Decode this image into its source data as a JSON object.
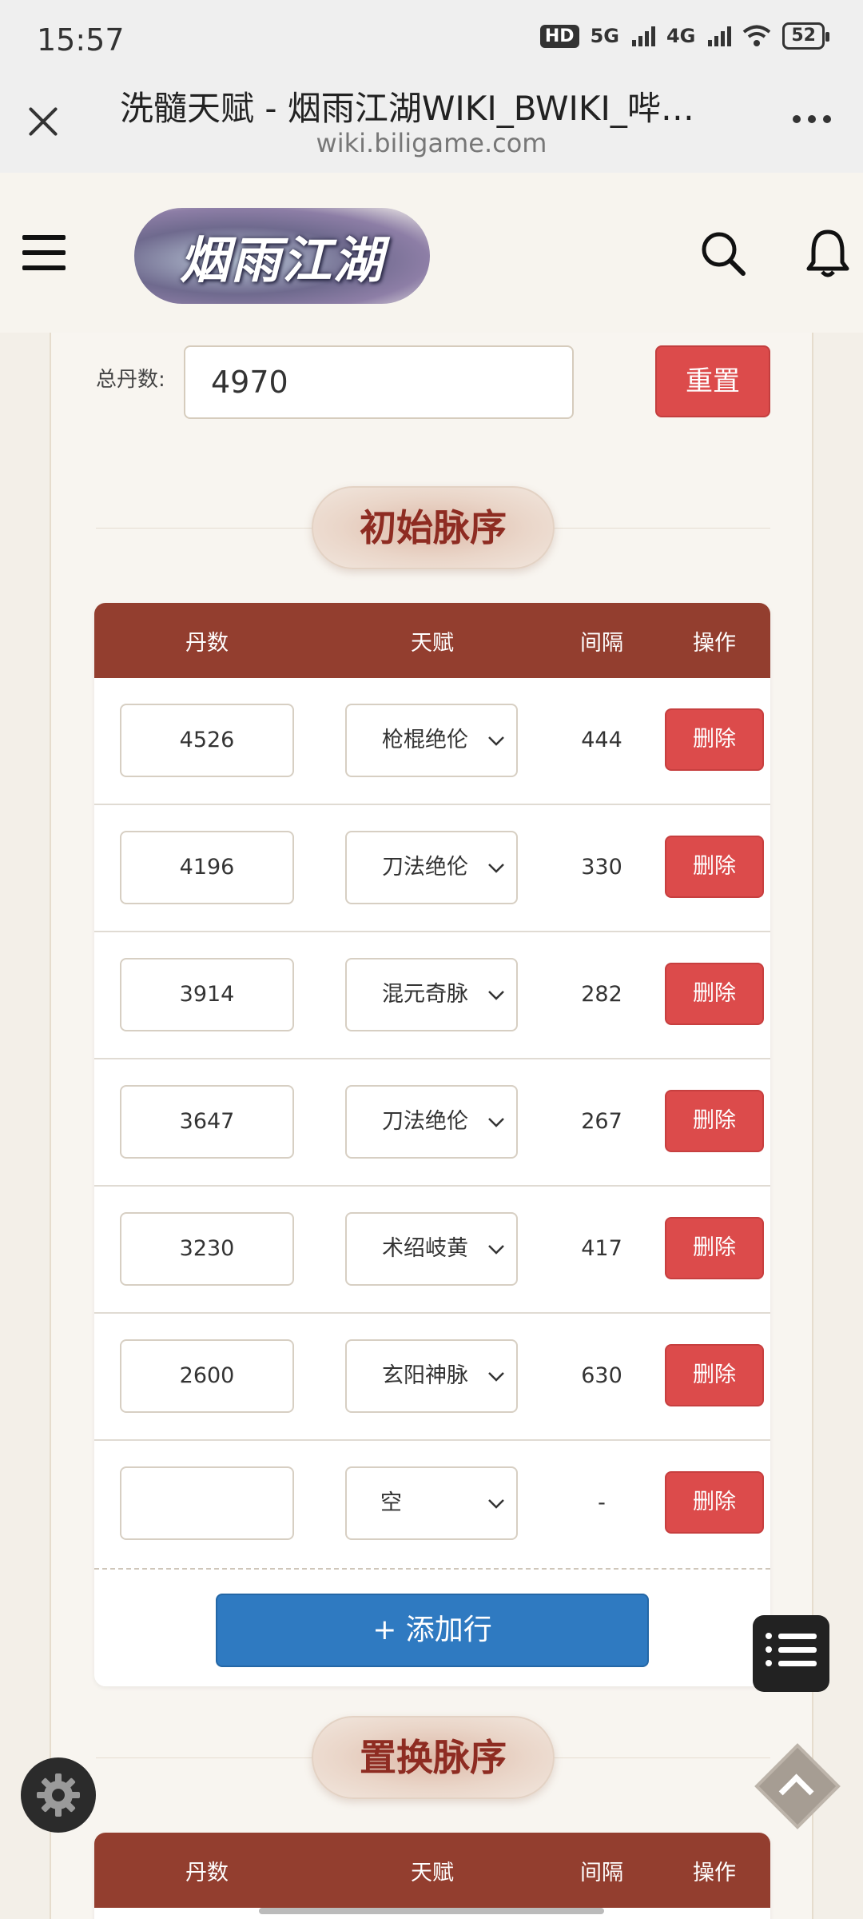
{
  "status_bar": {
    "time": "15:57",
    "network_hd": "HD",
    "network_5g": "5G",
    "network_4g": "4G",
    "battery": "52"
  },
  "browser": {
    "title": "洗髓天赋 - 烟雨江湖WIKI_BWIKI_哔哩哔哩",
    "url": "wiki.biligame.com"
  },
  "site": {
    "logo_text": "烟雨江湖"
  },
  "calculator": {
    "total_label": "总丹数:",
    "total_value": "4970",
    "reset_label": "重置"
  },
  "initial_section": {
    "title": "初始脉序",
    "headers": [
      "丹数",
      "天赋",
      "间隔",
      "操作"
    ],
    "rows": [
      {
        "dan": "4526",
        "talent": "枪棍绝伦",
        "gap": "444",
        "action": "删除"
      },
      {
        "dan": "4196",
        "talent": "刀法绝伦",
        "gap": "330",
        "action": "删除"
      },
      {
        "dan": "3914",
        "talent": "混元奇脉",
        "gap": "282",
        "action": "删除"
      },
      {
        "dan": "3647",
        "talent": "刀法绝伦",
        "gap": "267",
        "action": "删除"
      },
      {
        "dan": "3230",
        "talent": "术绍岐黄",
        "gap": "417",
        "action": "删除"
      },
      {
        "dan": "2600",
        "talent": "玄阳神脉",
        "gap": "630",
        "action": "删除"
      },
      {
        "dan": "",
        "talent": "空",
        "gap": "-",
        "action": "删除"
      }
    ],
    "add_row_label": "+ 添加行"
  },
  "replace_section": {
    "title": "置换脉序",
    "headers": [
      "丹数",
      "天赋",
      "间隔",
      "操作"
    ]
  },
  "colors": {
    "header_brown": "#933e2f",
    "delete_red": "#dc4b4b",
    "add_blue": "#2f7ac1",
    "title_text": "#8e2c22"
  },
  "icons": [
    "close-icon",
    "more-icon",
    "hamburger-icon",
    "search-icon",
    "bell-icon",
    "chevron-down-icon",
    "list-icon",
    "gear-icon",
    "back-to-top-icon"
  ]
}
